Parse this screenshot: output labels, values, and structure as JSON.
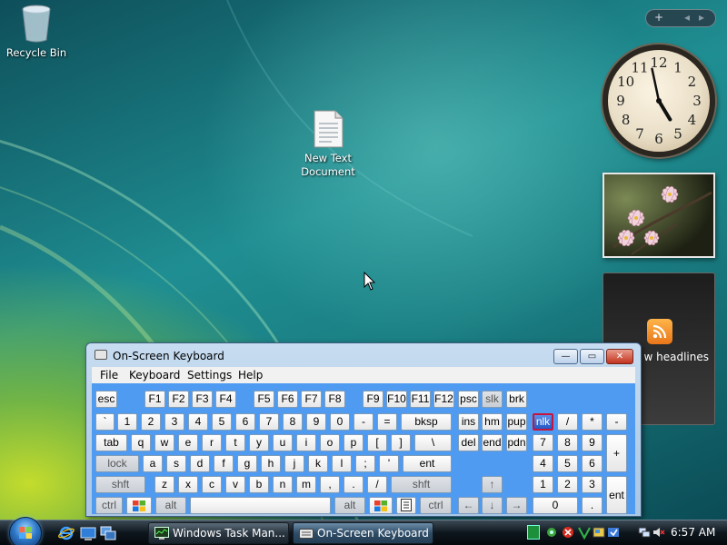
{
  "desktop": {
    "icons": [
      {
        "label": "Recycle Bin"
      },
      {
        "label_line1": "New Text",
        "label_line2": "Document"
      }
    ]
  },
  "gadgets": {
    "toolbar": {
      "add": "+",
      "prev": "◂",
      "next": "▸"
    },
    "clock": {
      "time_shown": "4:58",
      "numerals": [
        "12",
        "1",
        "2",
        "3",
        "4",
        "5",
        "6",
        "7",
        "8",
        "9",
        "10",
        "11"
      ]
    },
    "feed": {
      "headline_text": "w headlines"
    }
  },
  "osk": {
    "title": "On-Screen Keyboard",
    "window_buttons": {
      "minimize": "—",
      "maximize": "▭",
      "close": "✕"
    },
    "menu": [
      "File",
      "Keyboard",
      "Settings",
      "Help"
    ],
    "keys": {
      "fn": [
        "esc",
        "F1",
        "F2",
        "F3",
        "F4",
        "F5",
        "F6",
        "F7",
        "F8",
        "F9",
        "F10",
        "F11",
        "F12",
        "psc",
        "slk",
        "brk"
      ],
      "num": [
        "`",
        "1",
        "2",
        "3",
        "4",
        "5",
        "6",
        "7",
        "8",
        "9",
        "0",
        "-",
        "=",
        "bksp",
        "ins",
        "hm",
        "pup",
        "nlk",
        "/",
        "*",
        "-"
      ],
      "top": [
        "tab",
        "q",
        "w",
        "e",
        "r",
        "t",
        "y",
        "u",
        "i",
        "o",
        "p",
        "[",
        "]",
        "\\",
        "del",
        "end",
        "pdn",
        "7",
        "8",
        "9",
        "+"
      ],
      "home": [
        "lock",
        "a",
        "s",
        "d",
        "f",
        "g",
        "h",
        "j",
        "k",
        "l",
        ";",
        "'",
        "ent",
        "4",
        "5",
        "6"
      ],
      "bottom": [
        "shft",
        "z",
        "x",
        "c",
        "v",
        "b",
        "n",
        "m",
        ",",
        ".",
        "/",
        "shft",
        "↑",
        "1",
        "2",
        "3",
        "ent"
      ],
      "space": [
        "ctrl",
        "alt",
        "alt",
        "ctrl",
        "←",
        "↓",
        "→",
        "0",
        "."
      ]
    },
    "active_key": "nlk",
    "dim_key": "slk"
  },
  "taskbar": {
    "buttons": [
      "Windows Task Man...",
      "On-Screen Keyboard"
    ],
    "clock": "6:57 AM"
  },
  "colors": {
    "keyboard_bg": "#4f9bf2",
    "active_key_border": "#c8143c",
    "taskbar": "#0e161d"
  }
}
